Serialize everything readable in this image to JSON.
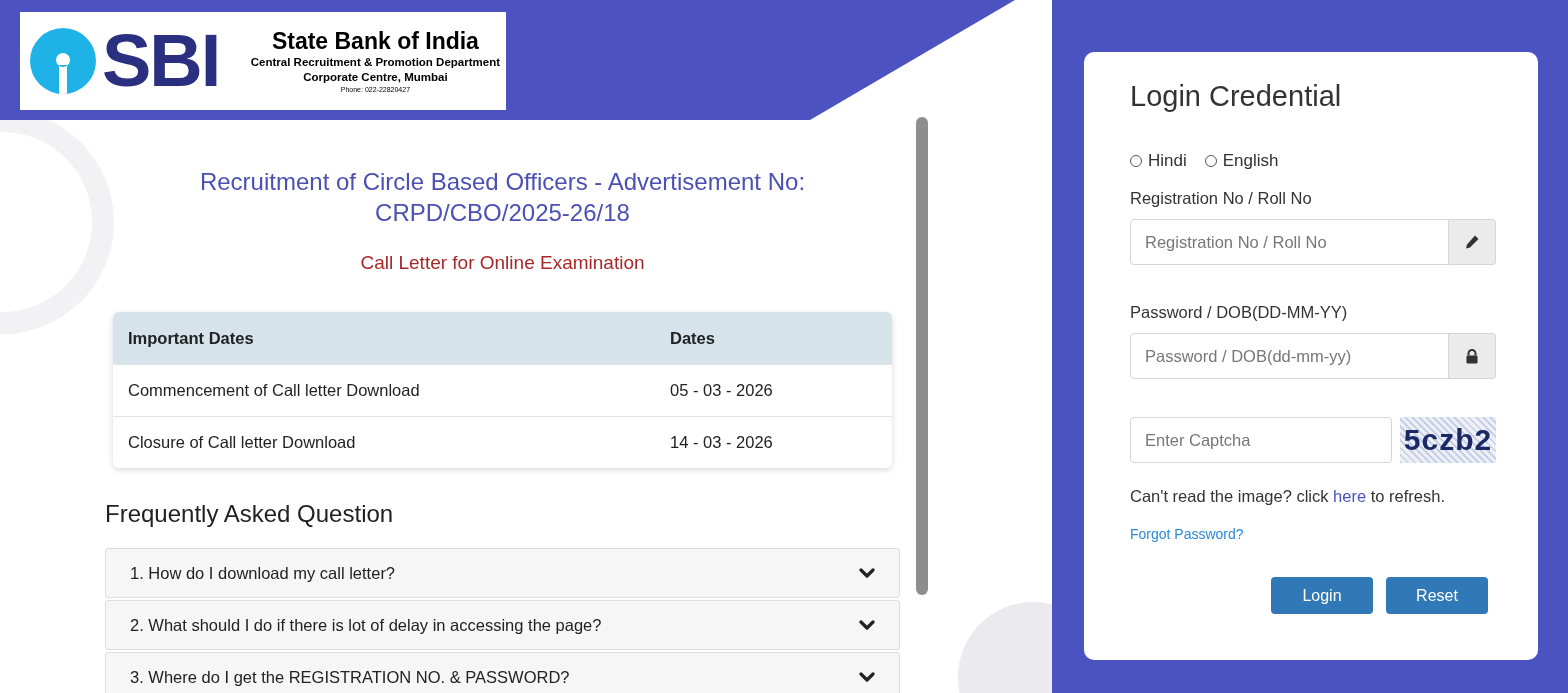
{
  "header": {
    "logo": {
      "mark": "SBI",
      "title": "State Bank of India",
      "lines": [
        "Central Recruitment & Promotion Department",
        "Corporate Centre, Mumbai"
      ],
      "phone": "Phone: 022-22820427"
    }
  },
  "main": {
    "title": "Recruitment of Circle Based Officers - Advertisement No: CRPD/CBO/2025-26/18",
    "subtitle": "Call Letter for Online Examination",
    "table": {
      "columns": [
        "Important Dates",
        "Dates"
      ],
      "rows": [
        [
          "Commencement of Call letter Download",
          "05 - 03 - 2026"
        ],
        [
          "Closure of Call letter Download",
          "14 - 03 - 2026"
        ]
      ]
    },
    "faq": {
      "title": "Frequently Asked Question",
      "items": [
        {
          "question": "1. How do I download my call letter?",
          "expanded": false
        },
        {
          "question": "2. What should I do if there is lot of delay in accessing the page?",
          "expanded": false
        },
        {
          "question": "3. Where do I get the REGISTRATION NO. & PASSWORD?",
          "expanded": false
        }
      ]
    }
  },
  "login": {
    "title": "Login Credential",
    "languages": [
      {
        "label": "Hindi",
        "selected": false
      },
      {
        "label": "English",
        "selected": false
      }
    ],
    "fields": [
      {
        "kind": "text",
        "label": "Registration No / Roll No",
        "placeholder": "Registration No / Roll No"
      },
      {
        "kind": "password",
        "label": "Password / DOB(DD-MM-YY)",
        "placeholder": "Password / DOB(dd-mm-yy)"
      }
    ],
    "captcha": {
      "placeholder": "Enter Captcha",
      "code": "5czb2"
    },
    "refresh_note": {
      "before": "Can't read the image? click",
      "link": "here",
      "after": "to refresh."
    },
    "forgot_link": "Forgot Password?",
    "buttons": [
      "Login",
      "Reset"
    ]
  }
}
